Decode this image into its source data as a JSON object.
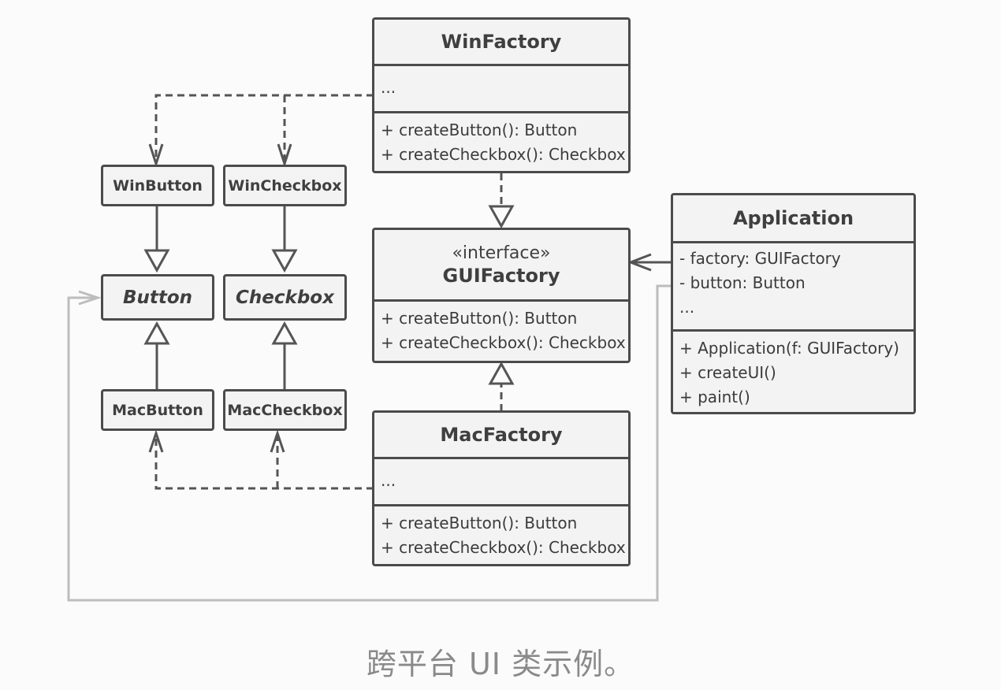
{
  "classes": {
    "win_factory": {
      "name": "WinFactory",
      "fields": [
        "..."
      ],
      "methods": [
        "+ createButton(): Button",
        "+ createCheckbox(): Checkbox"
      ]
    },
    "gui_factory": {
      "stereotype": "«interface»",
      "name": "GUIFactory",
      "methods": [
        "+ createButton(): Button",
        "+ createCheckbox(): Checkbox"
      ]
    },
    "mac_factory": {
      "name": "MacFactory",
      "fields": [
        "..."
      ],
      "methods": [
        "+ createButton(): Button",
        "+ createCheckbox(): Checkbox"
      ]
    },
    "application": {
      "name": "Application",
      "fields": [
        "- factory: GUIFactory",
        "- button: Button",
        "..."
      ],
      "methods": [
        "+ Application(f: GUIFactory)",
        "+ createUI()",
        "+ paint()"
      ]
    },
    "win_button": {
      "name": "WinButton"
    },
    "win_checkbox": {
      "name": "WinCheckbox"
    },
    "button": {
      "name": "Button"
    },
    "checkbox": {
      "name": "Checkbox"
    },
    "mac_button": {
      "name": "MacButton"
    },
    "mac_checkbox": {
      "name": "MacCheckbox"
    }
  },
  "caption": "跨平台 UI 类示例。",
  "colors": {
    "stroke": "#4b4b4b",
    "box_fill": "#f3f3f3",
    "light_line": "#bdbdbd",
    "caption": "#8a8a8a"
  }
}
